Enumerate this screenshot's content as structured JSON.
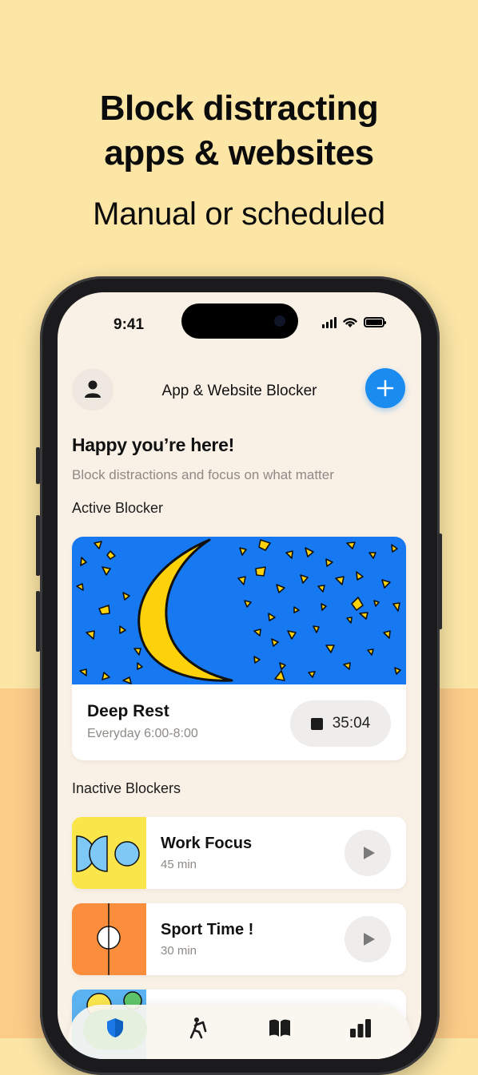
{
  "promo": {
    "headline_line1": "Block distracting",
    "headline_line2": "apps & websites",
    "subheadline": "Manual or scheduled"
  },
  "status_bar": {
    "time": "9:41"
  },
  "nav": {
    "title": "App & Website Blocker"
  },
  "greeting": {
    "title": "Happy you’re here!",
    "subtitle": "Block distractions and focus on what matter"
  },
  "active_section": {
    "heading": "Active Blocker",
    "blocker": {
      "name": "Deep Rest",
      "schedule": "Everyday 6:00-8:00",
      "timer": "35:04"
    }
  },
  "inactive_section": {
    "heading": "Inactive Blockers",
    "blockers": [
      {
        "name": "Work Focus",
        "duration": "45 min",
        "thumb_color": "#FAE64B"
      },
      {
        "name": "Sport Time !",
        "duration": "30 min",
        "thumb_color": "#FA8E3C"
      },
      {
        "name": "",
        "duration": "",
        "thumb_color": "#5AB2F0"
      }
    ]
  },
  "tabs": [
    {
      "icon": "shield-icon",
      "active": true
    },
    {
      "icon": "golf-icon",
      "active": false
    },
    {
      "icon": "book-icon",
      "active": false
    },
    {
      "icon": "bar-chart-icon",
      "active": false
    }
  ],
  "colors": {
    "background_top": "#FBE6A6",
    "background_bottom": "#FBCB88",
    "accent_blue": "#1A8CF0",
    "screen_bg": "#FAF1E6",
    "art_blue": "#1779F2",
    "moon_yellow": "#FDD20A"
  }
}
